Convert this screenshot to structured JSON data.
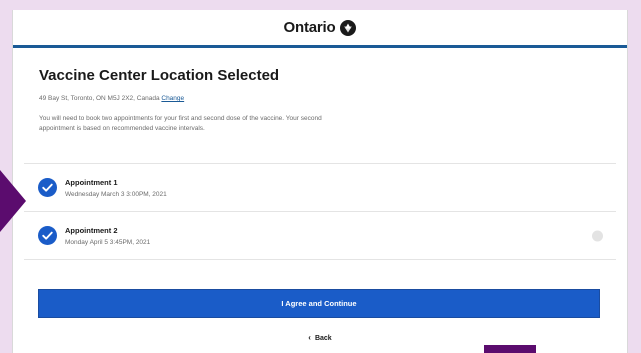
{
  "header": {
    "brand": "Ontario",
    "logo_icon": "ontario-trillium-icon"
  },
  "main": {
    "title": "Vaccine Center Location Selected",
    "address": "49 Bay St, Toronto, ON M5J 2X2, Canada",
    "change_label": "Change",
    "info": "You will need to book two appointments for your first and second dose of the vaccine. Your second appointment is based on recommended vaccine intervals."
  },
  "appointments": [
    {
      "title": "Appointment 1",
      "datetime": "Wednesday March 3 3:00PM, 2021",
      "icon": "check-circle-icon"
    },
    {
      "title": "Appointment 2",
      "datetime": "Monday April 5 3:45PM, 2021",
      "icon": "check-circle-icon"
    }
  ],
  "actions": {
    "agree_label": "I Agree and Continue",
    "back_label": "Back"
  },
  "colors": {
    "accent": "#1a5a96",
    "button": "#1a5cc8",
    "background": "#eddcef",
    "annotation": "#5b0c6e"
  }
}
